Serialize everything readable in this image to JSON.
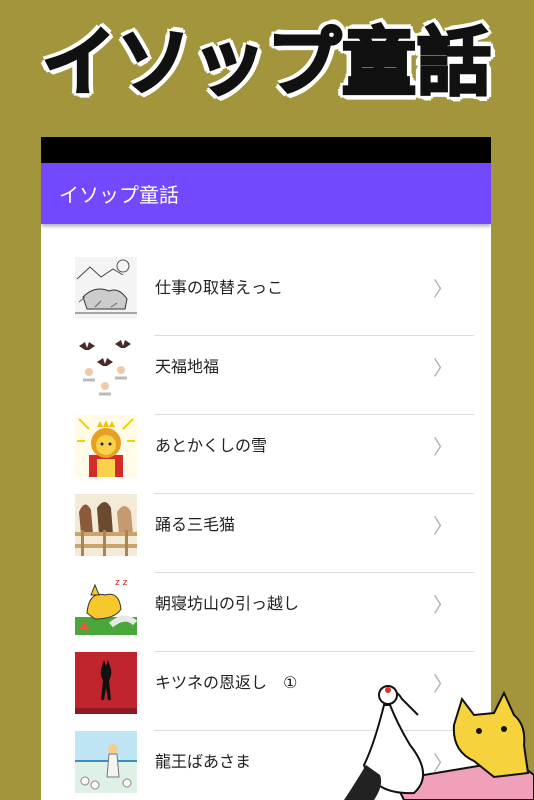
{
  "promo": {
    "title": "イソップ童話"
  },
  "app_bar": {
    "title": "イソップ童話"
  },
  "stories": [
    {
      "label": "仕事の取替えっこ",
      "icon": "sketch-lion-landscape-thumbnail"
    },
    {
      "label": "天福地福",
      "icon": "bats-and-cherubs-thumbnail"
    },
    {
      "label": "あとかくしの雪",
      "icon": "lion-king-thumbnail"
    },
    {
      "label": "踊る三毛猫",
      "icon": "horses-in-pen-thumbnail"
    },
    {
      "label": "朝寝坊山の引っ越し",
      "icon": "sleeping-fox-thumbnail"
    },
    {
      "label": "キツネの恩返し　①",
      "icon": "red-fox-silhouette-thumbnail"
    },
    {
      "label": "龍王ばあさま",
      "icon": "girl-by-sea-thumbnail"
    }
  ],
  "colors": {
    "background": "#a3953b",
    "app_bar": "#7249fc",
    "status_bar": "#000000"
  }
}
